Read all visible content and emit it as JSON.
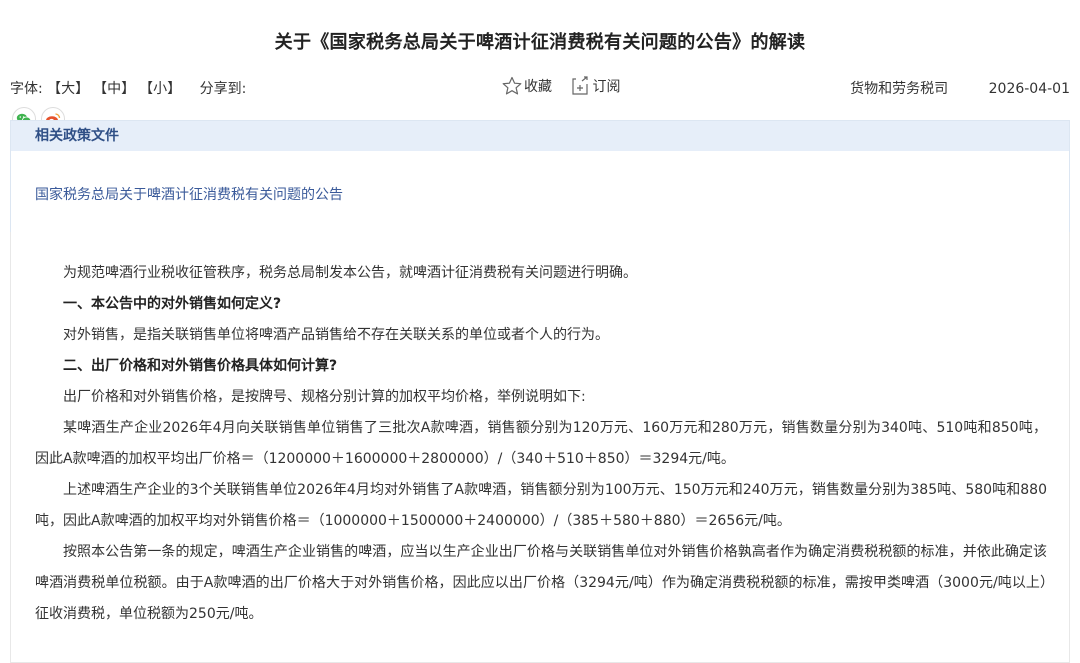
{
  "title": "关于《国家税务总局关于啤酒计征消费税有关问题的公告》的解读",
  "toolbar": {
    "font_size_label": "字体:",
    "size_large": "【大】",
    "size_medium": "【中】",
    "size_small": "【小】",
    "share_label": "分享到:",
    "favorite_label": "收藏",
    "subscribe_label": "订阅",
    "department": "货物和劳务税司",
    "date": "2026-04-01"
  },
  "share": {
    "icons": [
      "wechat-icon",
      "weibo-icon"
    ]
  },
  "related": {
    "heading": "相关政策文件",
    "link": "国家税务总局关于啤酒计征消费税有关问题的公告"
  },
  "article": {
    "p1": "为规范啤酒行业税收征管秩序，税务总局制发本公告，就啤酒计征消费税有关问题进行明确。",
    "h1": "一、本公告中的对外销售如何定义?",
    "p2": "对外销售，是指关联销售单位将啤酒产品销售给不存在关联关系的单位或者个人的行为。",
    "h2": "二、出厂价格和对外销售价格具体如何计算?",
    "p3": "出厂价格和对外销售价格，是按牌号、规格分别计算的加权平均价格，举例说明如下:",
    "p4": "某啤酒生产企业2026年4月向关联销售单位销售了三批次A款啤酒，销售额分别为120万元、160万元和280万元，销售数量分别为340吨、510吨和850吨，因此A款啤酒的加权平均出厂价格＝（1200000＋1600000＋2800000）/（340＋510＋850）＝3294元/吨。",
    "p5": "上述啤酒生产企业的3个关联销售单位2026年4月均对外销售了A款啤酒，销售额分别为100万元、150万元和240万元，销售数量分别为385吨、580吨和880吨，因此A款啤酒的加权平均对外销售价格＝（1000000＋1500000＋2400000）/（385＋580＋880）＝2656元/吨。",
    "p6": "按照本公告第一条的规定，啤酒生产企业销售的啤酒，应当以生产企业出厂价格与关联销售单位对外销售价格孰高者作为确定消费税税额的标准，并依此确定该啤酒消费税单位税额。由于A款啤酒的出厂价格大于对外销售价格，因此应以出厂价格（3294元/吨）作为确定消费税税额的标准，需按甲类啤酒（3000元/吨以上）征收消费税，单位税额为250元/吨。"
  },
  "colors": {
    "related_header_bg": "#e6eef9",
    "link": "#3a5a9a",
    "wechat": "#3fb34f",
    "weibo": "#e6522c"
  }
}
